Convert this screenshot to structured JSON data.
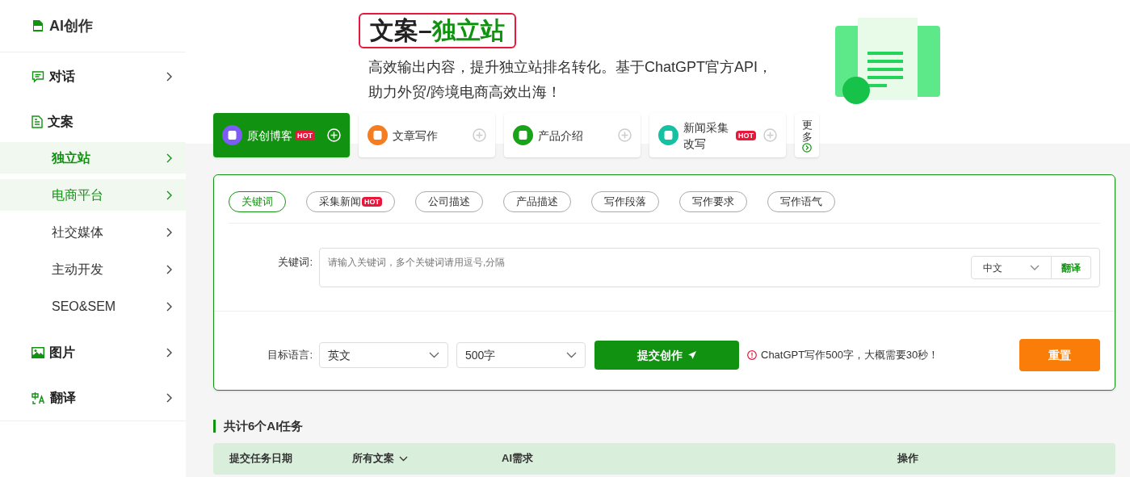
{
  "sidebar": {
    "header": "AI创作",
    "groups": [
      {
        "label": "对话"
      },
      {
        "label": "文案",
        "children": [
          {
            "label": "独立站",
            "selected": true,
            "highlighted": true
          },
          {
            "label": "电商平台",
            "selected": false,
            "highlighted": true
          },
          {
            "label": "社交媒体",
            "selected": false,
            "highlighted": false
          },
          {
            "label": "主动开发",
            "selected": false,
            "highlighted": false
          },
          {
            "label": "SEO&SEM",
            "selected": false,
            "highlighted": false
          }
        ]
      },
      {
        "label": "图片"
      },
      {
        "label": "翻译"
      }
    ]
  },
  "hero": {
    "title_prefix": "文案–",
    "title_highlight": "独立站",
    "description": "高效输出内容，提升独立站排名转化。基于ChatGPT官方API，助力外贸/跨境电商高效出海！"
  },
  "tools": [
    {
      "label": "原创博客",
      "badge": "HOT",
      "color": "#7c5cf5",
      "selected": true
    },
    {
      "label": "文章写作",
      "color": "#f57c1f",
      "selected": false
    },
    {
      "label": "产品介绍",
      "color": "#19a319",
      "selected": false
    },
    {
      "label": "新闻采集改写",
      "badge": "HOT",
      "color": "#14c1a0",
      "selected": false
    }
  ],
  "more_label": "更多",
  "form": {
    "tags": [
      {
        "label": "关键词",
        "selected": true
      },
      {
        "label": "采集新闻",
        "badge": "HOT",
        "selected": false
      },
      {
        "label": "公司描述",
        "selected": false
      },
      {
        "label": "产品描述",
        "selected": false
      },
      {
        "label": "写作段落",
        "selected": false
      },
      {
        "label": "写作要求",
        "selected": false
      },
      {
        "label": "写作语气",
        "selected": false
      }
    ],
    "keyword_label": "关键词:",
    "keyword_placeholder": "请输入关键词，多个关键词请用逗号,分隔",
    "source_language": "中文",
    "translate_button": "翻译",
    "target_label": "目标语言:",
    "target_language": "英文",
    "length": "500字",
    "submit_button": "提交创作",
    "notice": "ChatGPT写作500字，大概需要30秒！",
    "reset_button": "重置"
  },
  "tasks": {
    "title": "共计6个AI任务",
    "columns": [
      "提交任务日期",
      "所有文案",
      "AI需求",
      "操作"
    ]
  }
}
